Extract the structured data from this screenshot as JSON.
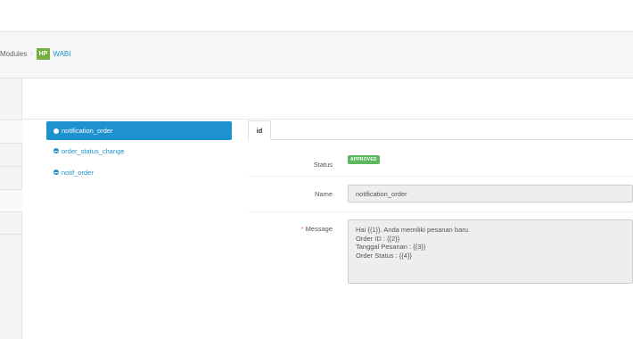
{
  "breadcrumb": {
    "modules": "Modules",
    "separator": "›",
    "logo_text": "HP",
    "current": "WABI"
  },
  "templates": [
    {
      "label": "notification_order",
      "active": true
    },
    {
      "label": "order_status_change",
      "active": false
    },
    {
      "label": "notif_order",
      "active": false
    }
  ],
  "tabs": [
    {
      "label": "id"
    }
  ],
  "form": {
    "status_label": "Status",
    "status_badge": "APPROVED",
    "name_label": "Name",
    "name_value": "notification_order",
    "message_required": "*",
    "message_label": "Message",
    "message_value": "Hai {{1}}. Anda memiliki pesanan baru.\nOrder ID : {{2}}\nTanggal Pesanan : {{3}}\nOrder Status : {{4}}"
  },
  "colors": {
    "accent": "#1e91cf",
    "approved": "#5cb85c",
    "logo": "#73b041",
    "required": "#f56b6b"
  }
}
